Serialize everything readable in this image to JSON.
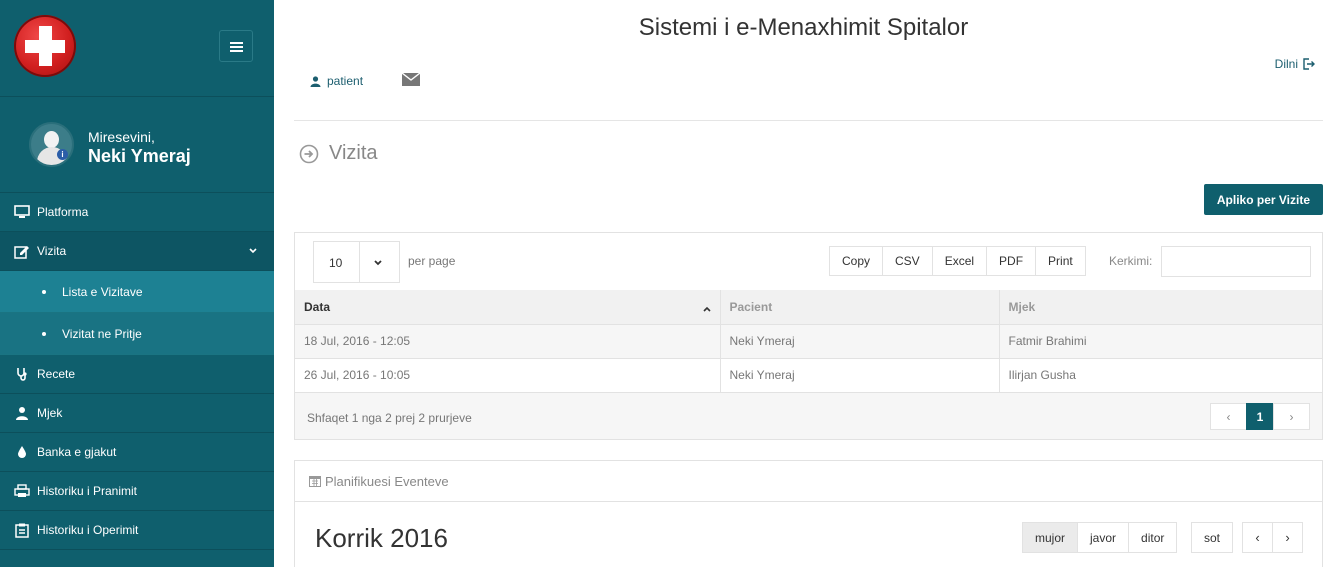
{
  "sidebar": {
    "greeting": "Miresevini,",
    "user_name": "Neki Ymeraj",
    "items": [
      {
        "label": "Platforma",
        "icon": "monitor-icon"
      },
      {
        "label": "Vizita",
        "icon": "edit-icon",
        "expanded": true,
        "children": [
          {
            "label": "Lista e Vizitave",
            "active": true
          },
          {
            "label": "Vizitat ne Pritje"
          }
        ]
      },
      {
        "label": "Recete",
        "icon": "stethoscope-icon"
      },
      {
        "label": "Mjek",
        "icon": "user-md-icon"
      },
      {
        "label": "Banka e gjakut",
        "icon": "drop-icon"
      },
      {
        "label": "Historiku i Pranimit",
        "icon": "printer-icon"
      },
      {
        "label": "Historiku i Operimit",
        "icon": "clipboard-icon"
      }
    ]
  },
  "header": {
    "title": "Sistemi i e-Menaxhimit Spitalor",
    "user_link": "patient",
    "logout": "Dilni"
  },
  "page": {
    "heading": "Vizita",
    "apply_button": "Apliko per Vizite"
  },
  "table": {
    "page_length": "10",
    "per_page_label": "per page",
    "export_buttons": [
      "Copy",
      "CSV",
      "Excel",
      "PDF",
      "Print"
    ],
    "search_label": "Kerkimi:",
    "search_value": "",
    "columns": [
      "Data",
      "Pacient",
      "Mjek"
    ],
    "rows": [
      [
        "18 Jul, 2016 - 12:05",
        "Neki Ymeraj",
        "Fatmir Brahimi"
      ],
      [
        "26 Jul, 2016 - 10:05",
        "Neki Ymeraj",
        "Ilirjan Gusha"
      ]
    ],
    "info": "Shfaqet 1 nga 2 prej 2 prurjeve",
    "pager": {
      "prev": "‹",
      "current": "1",
      "next": "›"
    }
  },
  "calendar": {
    "panel_title": "Planifikuesi Eventeve",
    "month_title": "Korrik 2016",
    "views": [
      "mujor",
      "javor",
      "ditor"
    ],
    "active_view": "mujor",
    "today": "sot",
    "prev": "‹",
    "next": "›"
  },
  "colors": {
    "sidebar": "#0f5f6d",
    "accent": "#0f5f6d",
    "sub_menu": "#197383"
  }
}
